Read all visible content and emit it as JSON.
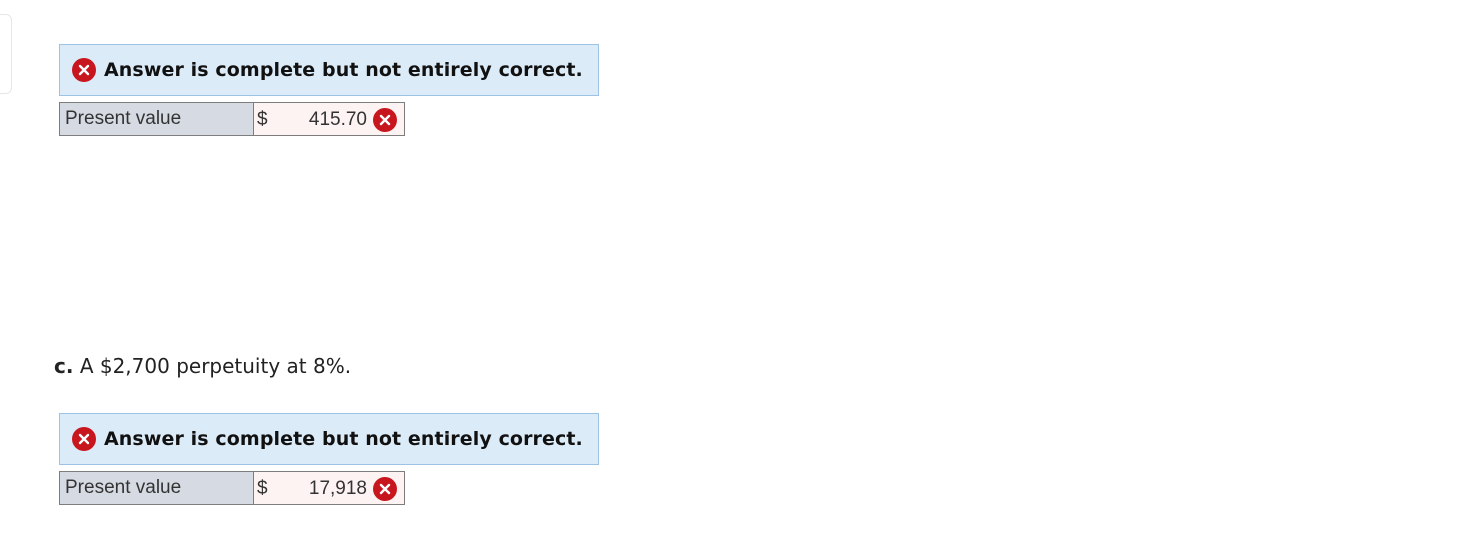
{
  "part_b": {
    "banner": {
      "message": "Answer is complete but not entirely correct.",
      "icon": "incorrect-x-icon",
      "icon_color": "#c8161e",
      "background": "#dcebf8"
    },
    "row": {
      "label": "Present value",
      "currency": "$",
      "value": "415.70",
      "status_icon": "incorrect-x-icon"
    }
  },
  "part_c": {
    "question_letter": "c.",
    "question_text": "A $2,700 perpetuity at 8%.",
    "banner": {
      "message": "Answer is complete but not entirely correct.",
      "icon": "incorrect-x-icon",
      "icon_color": "#c8161e",
      "background": "#dcebf8"
    },
    "row": {
      "label": "Present value",
      "currency": "$",
      "value": "17,918",
      "status_icon": "incorrect-x-icon"
    }
  }
}
